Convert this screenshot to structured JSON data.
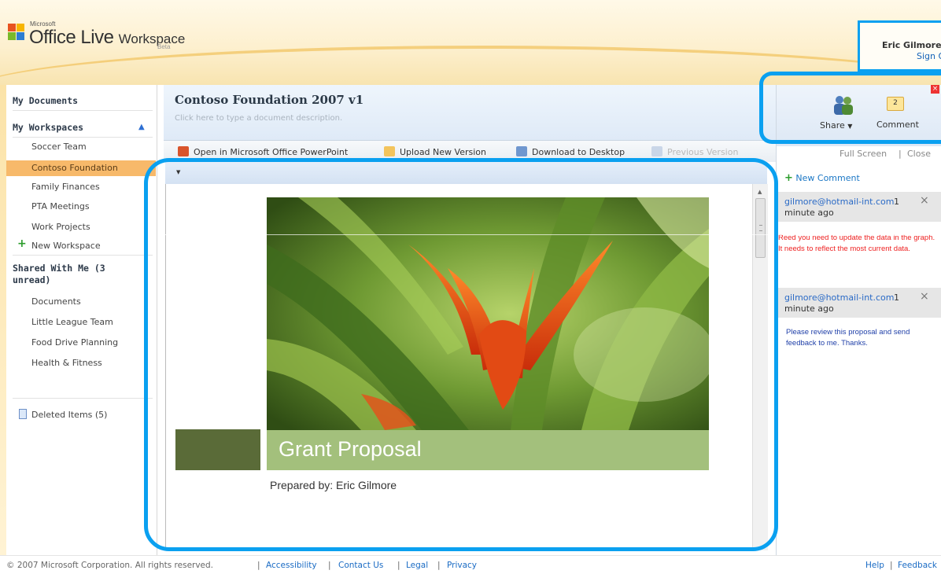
{
  "header": {
    "logo_small": "Microsoft",
    "logo_office": "Office Live ",
    "logo_workspace": "Workspace",
    "logo_beta": "Beta",
    "user_name": "Eric Gilmore",
    "sign_out": "Sign Out"
  },
  "sidebar": {
    "my_documents": "My Documents",
    "my_workspaces": "My Workspaces",
    "workspaces": [
      "Soccer Team",
      "Contoso Foundation",
      "Family Finances",
      "PTA Meetings",
      "Work Projects"
    ],
    "selected_workspace": "Contoso Foundation",
    "new_workspace": "New Workspace",
    "shared_with_me": "Shared With Me (3 unread)",
    "shared": [
      "Documents",
      "Little League Team",
      "Food Drive Planning",
      "Health & Fitness"
    ],
    "deleted_items": "Deleted Items (5)"
  },
  "document": {
    "title": "Contoso Foundation 2007 v1",
    "description_placeholder": "Click here to type a document description."
  },
  "toolbar": {
    "open_in_powerpoint": "Open in Microsoft Office PowerPoint",
    "upload_new_version": "Upload New Version",
    "download_to_desktop": "Download to Desktop",
    "previous_version": "Previous Version"
  },
  "slide": {
    "title": "Grant Proposal",
    "subtitle": "Prepared by: Eric Gilmore"
  },
  "right_panel": {
    "share_label": "Share",
    "comment_label": "Comment",
    "comment_count": "2",
    "full_screen": "Full Screen",
    "separator": "|",
    "close": "Close",
    "new_comment": "New Comment",
    "comments": [
      {
        "author": "gilmore@hotmail-int.com",
        "count": "1",
        "time": "minute ago",
        "text": "Reed you need to update the data in the graph. It needs to reflect the most current data."
      },
      {
        "author": "gilmore@hotmail-int.com",
        "count": "1",
        "time": "minute ago",
        "text": "Please review this proposal and send feedback to me. Thanks."
      }
    ]
  },
  "footer": {
    "copyright": "© 2007 Microsoft Corporation. All rights reserved.",
    "accessibility": "Accessibility",
    "contact_us": "Contact Us",
    "legal": "Legal",
    "privacy": "Privacy",
    "help": "Help",
    "feedback": "Feedback",
    "separator": "|"
  },
  "colors": {
    "highlight": "#0aa0f0",
    "selected_nav": "#f7b96a",
    "slide_band": "#a3c07c",
    "slide_block": "#5a6b38",
    "link": "#1a6bc4"
  }
}
